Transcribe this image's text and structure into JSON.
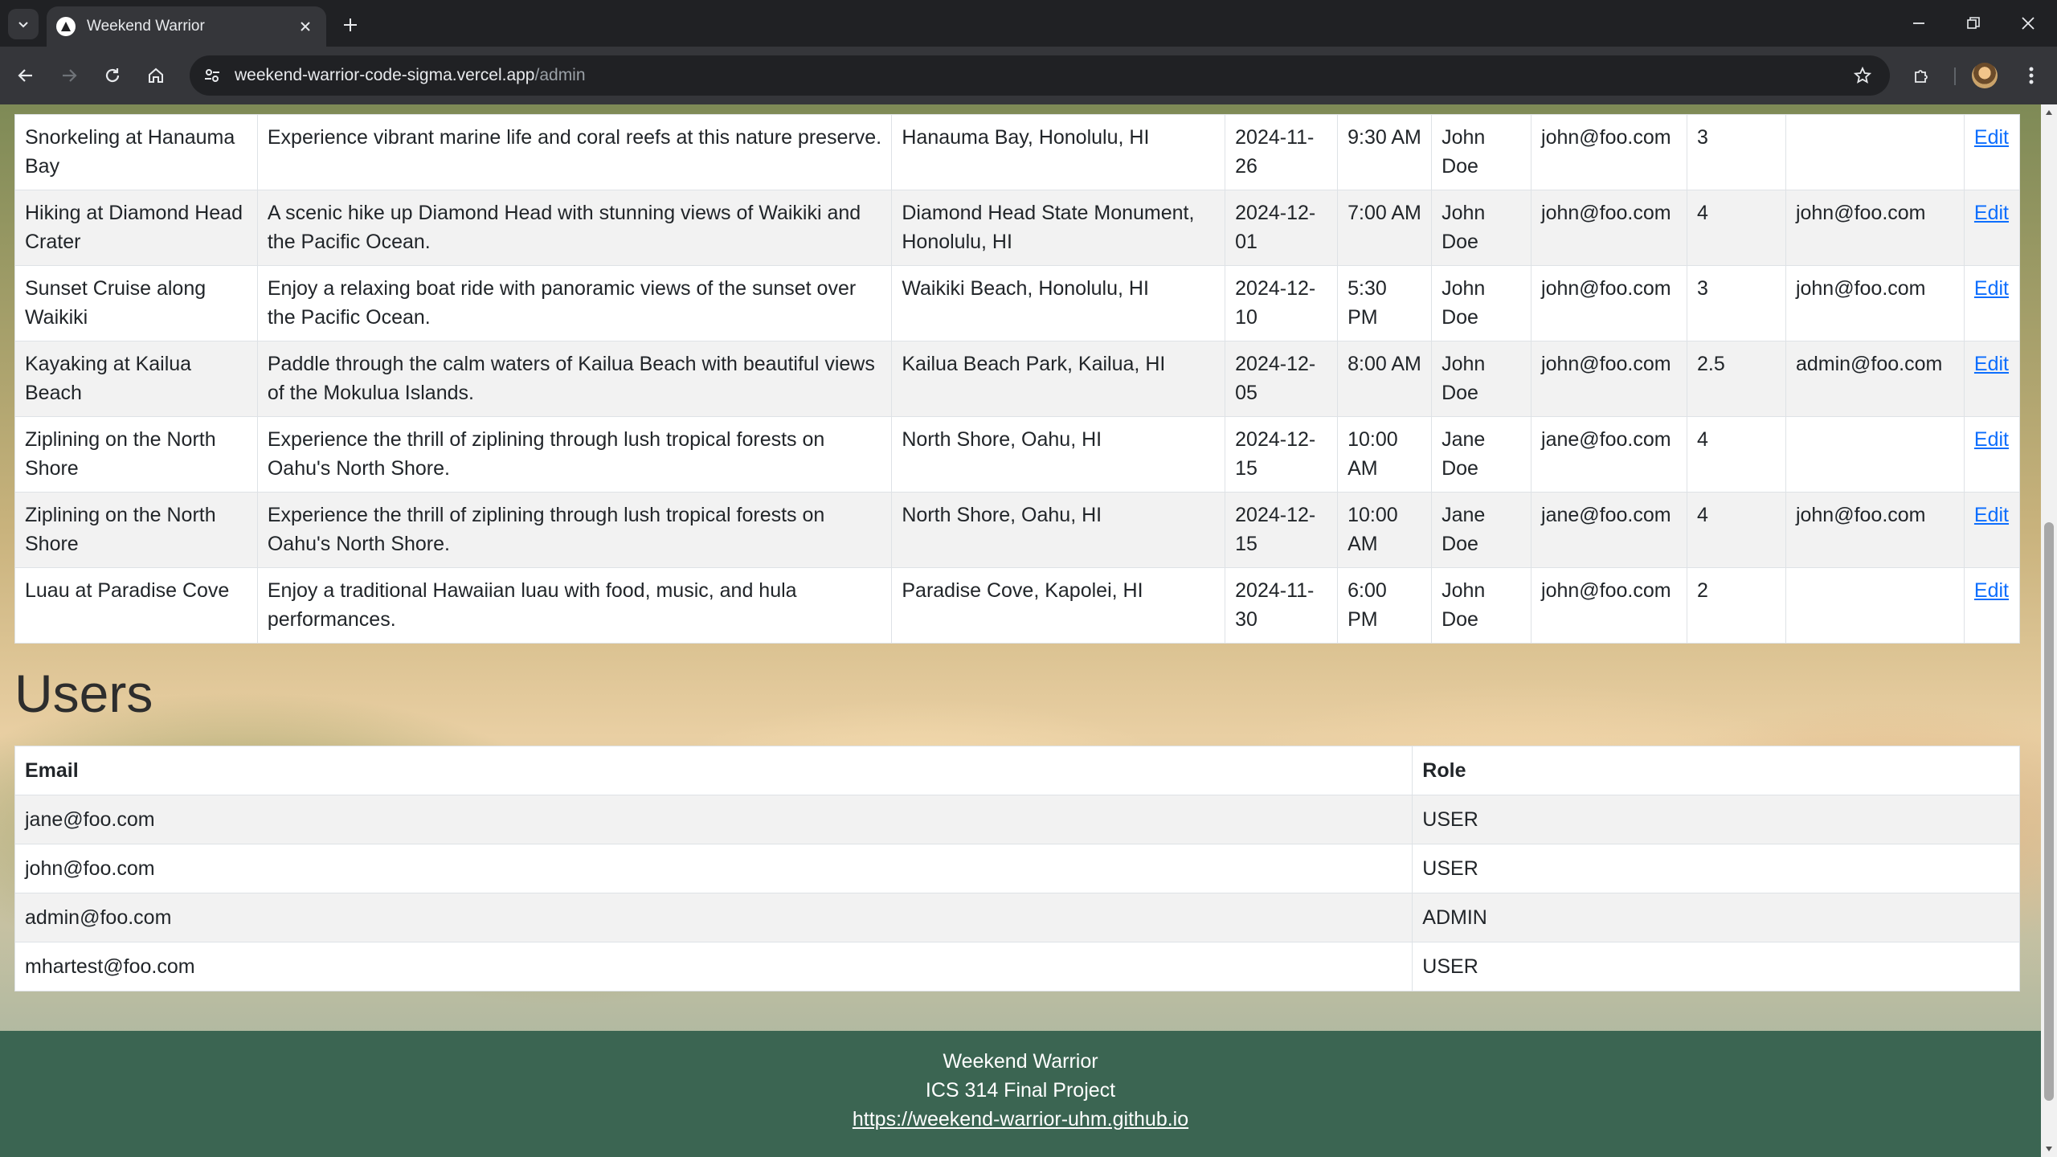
{
  "browser": {
    "tab_title": "Weekend Warrior",
    "url_host": "weekend-warrior-code-sigma.vercel.app",
    "url_path": "/admin"
  },
  "events": {
    "rows": [
      {
        "name": "Snorkeling at Hanauma Bay",
        "description": "Experience vibrant marine life and coral reefs at this nature preserve.",
        "location": "Hanauma Bay, Honolulu, HI",
        "date": "2024-11-26",
        "time": "9:30 AM",
        "organizer": "John Doe",
        "email": "john@foo.com",
        "hours": "3",
        "attendee": "",
        "action": "Edit"
      },
      {
        "name": "Hiking at Diamond Head Crater",
        "description": "A scenic hike up Diamond Head with stunning views of Waikiki and the Pacific Ocean.",
        "location": "Diamond Head State Monument, Honolulu, HI",
        "date": "2024-12-01",
        "time": "7:00 AM",
        "organizer": "John Doe",
        "email": "john@foo.com",
        "hours": "4",
        "attendee": "john@foo.com",
        "action": "Edit"
      },
      {
        "name": "Sunset Cruise along Waikiki",
        "description": "Enjoy a relaxing boat ride with panoramic views of the sunset over the Pacific Ocean.",
        "location": "Waikiki Beach, Honolulu, HI",
        "date": "2024-12-10",
        "time": "5:30 PM",
        "organizer": "John Doe",
        "email": "john@foo.com",
        "hours": "3",
        "attendee": "john@foo.com",
        "action": "Edit"
      },
      {
        "name": "Kayaking at Kailua Beach",
        "description": "Paddle through the calm waters of Kailua Beach with beautiful views of the Mokulua Islands.",
        "location": "Kailua Beach Park, Kailua, HI",
        "date": "2024-12-05",
        "time": "8:00 AM",
        "organizer": "John Doe",
        "email": "john@foo.com",
        "hours": "2.5",
        "attendee": "admin@foo.com",
        "action": "Edit"
      },
      {
        "name": "Ziplining on the North Shore",
        "description": "Experience the thrill of ziplining through lush tropical forests on Oahu's North Shore.",
        "location": "North Shore, Oahu, HI",
        "date": "2024-12-15",
        "time": "10:00 AM",
        "organizer": "Jane Doe",
        "email": "jane@foo.com",
        "hours": "4",
        "attendee": "",
        "action": "Edit"
      },
      {
        "name": "Ziplining on the North Shore",
        "description": "Experience the thrill of ziplining through lush tropical forests on Oahu's North Shore.",
        "location": "North Shore, Oahu, HI",
        "date": "2024-12-15",
        "time": "10:00 AM",
        "organizer": "Jane Doe",
        "email": "jane@foo.com",
        "hours": "4",
        "attendee": "john@foo.com",
        "action": "Edit"
      },
      {
        "name": "Luau at Paradise Cove",
        "description": "Enjoy a traditional Hawaiian luau with food, music, and hula performances.",
        "location": "Paradise Cove, Kapolei, HI",
        "date": "2024-11-30",
        "time": "6:00 PM",
        "organizer": "John Doe",
        "email": "john@foo.com",
        "hours": "2",
        "attendee": "",
        "action": "Edit"
      }
    ]
  },
  "users": {
    "title": "Users",
    "headers": {
      "email": "Email",
      "role": "Role"
    },
    "rows": [
      {
        "email": "jane@foo.com",
        "role": "USER"
      },
      {
        "email": "john@foo.com",
        "role": "USER"
      },
      {
        "email": "admin@foo.com",
        "role": "ADMIN"
      },
      {
        "email": "mhartest@foo.com",
        "role": "USER"
      }
    ]
  },
  "footer": {
    "line1": "Weekend Warrior",
    "line2": "ICS 314 Final Project",
    "link": "https://weekend-warrior-uhm.github.io"
  }
}
